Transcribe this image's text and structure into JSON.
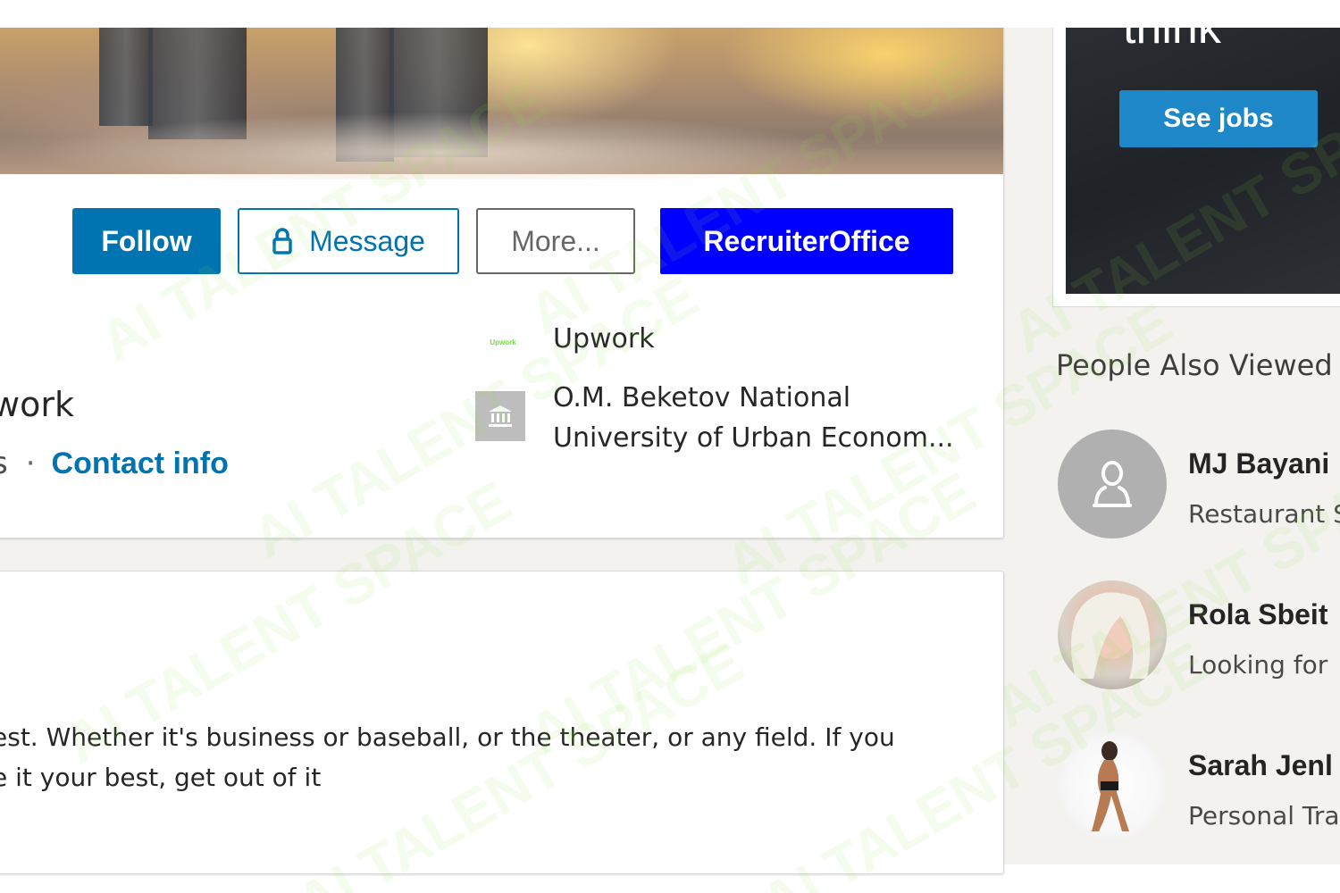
{
  "profile": {
    "actions": {
      "follow_label": "Follow",
      "message_label": "Message",
      "more_label": "More...",
      "recruiter_label": "RecruiterOffice"
    },
    "headline_fragment": "work",
    "location_fragment": "s",
    "separator": "·",
    "contact_info_label": "Contact info",
    "current_company": "Upwork",
    "company_logo_text": "Upwork",
    "education": "O.M. Beketov National University of Urban Econom..."
  },
  "about": {
    "line1": "est. Whether it's business or baseball, or the theater, or any field. If you",
    "line2": "e it your best, get out of it"
  },
  "ad": {
    "headline_fragment": "think",
    "cta_label": "See jobs"
  },
  "people_also_viewed": {
    "title": "People Also Viewed",
    "people": [
      {
        "name": "MJ Bayani",
        "subtitle": "Restaurant S"
      },
      {
        "name": "Rola Sbeit",
        "subtitle": "Looking for"
      },
      {
        "name": "Sarah Jenl",
        "subtitle": "Personal Tra"
      }
    ]
  },
  "watermark_text": "AI TALENT SPACE",
  "colors": {
    "primary_blue": "#0073b1",
    "recruiter_blue": "#0000ff",
    "see_jobs_blue": "#1d87c8",
    "watermark_green": "#96e650"
  }
}
